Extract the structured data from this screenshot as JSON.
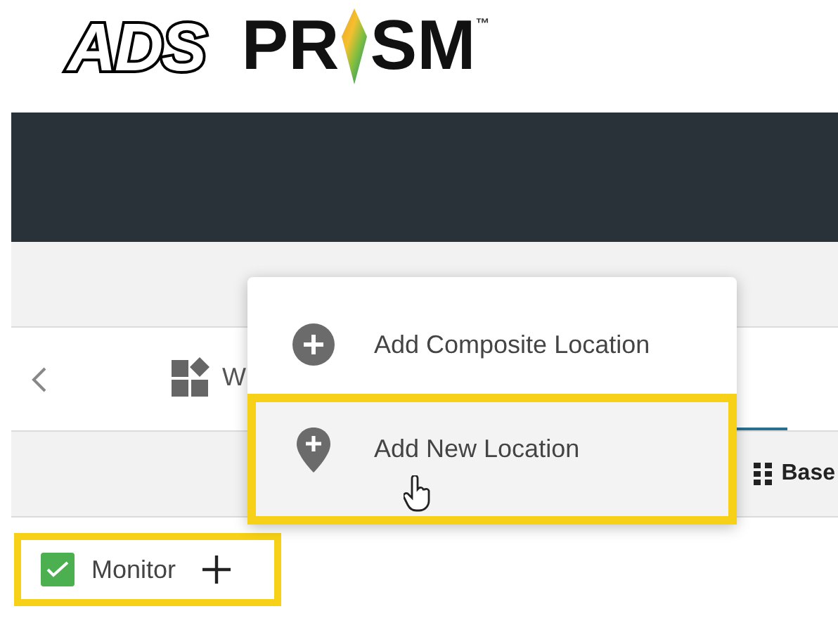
{
  "logo": {
    "brand": "ADS",
    "product_left": "PR",
    "product_right": "SM",
    "trademark": "™"
  },
  "tabs": [
    {
      "label": "W",
      "selected": false
    }
  ],
  "toolbar": {
    "view_label": "Base"
  },
  "menu": {
    "items": [
      {
        "label": "Add Composite Location",
        "kind": "composite",
        "selected": false
      },
      {
        "label": "Add New Location",
        "kind": "location",
        "selected": true
      }
    ]
  },
  "filter": {
    "label": "Monitor",
    "checked": true,
    "highlighted": true
  }
}
